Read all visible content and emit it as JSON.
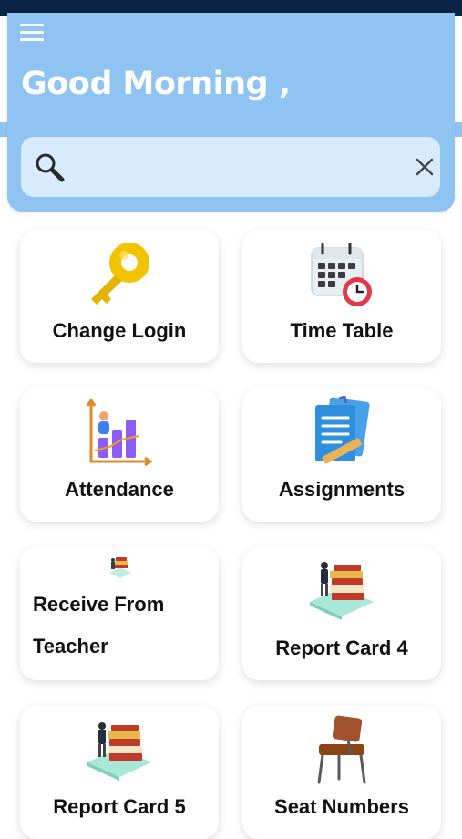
{
  "header": {
    "greeting": "Good Morning ,",
    "menu_icon": "hamburger-menu-icon",
    "search": {
      "value": "",
      "placeholder": "",
      "icon": "search-icon",
      "clear_icon": "close-icon"
    }
  },
  "colors": {
    "header_bg": "#8fc4f2",
    "status_bar": "#0b2346",
    "search_bg": "#d8ebfc"
  },
  "tiles": [
    {
      "label": "Change Login",
      "icon": "key-icon"
    },
    {
      "label": "Time Table",
      "icon": "calendar-clock-icon"
    },
    {
      "label": "Attendance",
      "icon": "bar-chart-icon"
    },
    {
      "label": "Assignments",
      "icon": "assignment-document-icon"
    },
    {
      "label_line1": "Receive From",
      "label_line2": "Teacher",
      "icon": "books-stack-icon"
    },
    {
      "label": "Report Card 4",
      "icon": "books-stack-icon"
    },
    {
      "label": "Report Card 5",
      "icon": "books-stack-icon"
    },
    {
      "label": "Seat Numbers",
      "icon": "school-desk-icon"
    }
  ]
}
